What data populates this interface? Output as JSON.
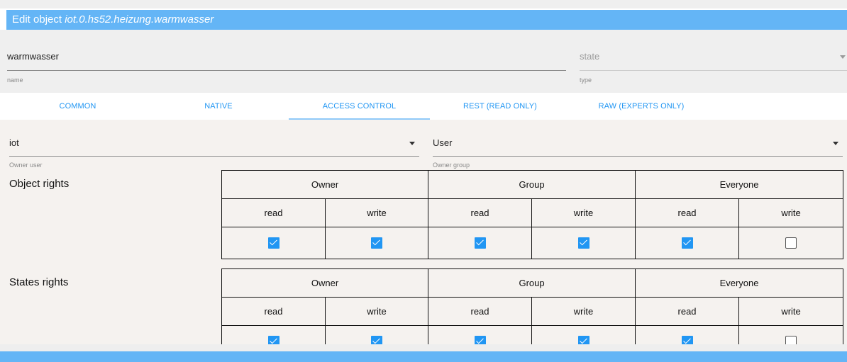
{
  "dialog": {
    "title_prefix": "Edit object",
    "object_id": "iot.0.hs52.heizung.warmwasser"
  },
  "fields": {
    "name": {
      "value": "warmwasser",
      "hint": "name"
    },
    "type": {
      "value": "state",
      "hint": "type"
    }
  },
  "tabs": [
    {
      "label": "COMMON"
    },
    {
      "label": "NATIVE"
    },
    {
      "label": "ACCESS CONTROL"
    },
    {
      "label": "REST (READ ONLY)"
    },
    {
      "label": "RAW (EXPERTS ONLY)"
    }
  ],
  "active_tab": "ACCESS CONTROL",
  "owner": {
    "user": {
      "value": "iot",
      "hint": "Owner user"
    },
    "group": {
      "value": "User",
      "hint": "Owner group"
    }
  },
  "rights_columns": {
    "groups": [
      "Owner",
      "Group",
      "Everyone"
    ],
    "ops": [
      "read",
      "write"
    ]
  },
  "object_rights": {
    "label": "Object rights",
    "checked": [
      true,
      true,
      true,
      true,
      true,
      false
    ]
  },
  "state_rights": {
    "label": "States rights",
    "checked": [
      true,
      true,
      true,
      true,
      true,
      false
    ]
  },
  "colors": {
    "accent": "#64b5f6",
    "checkbox": "#2196f3",
    "tab_text": "#2196f3"
  }
}
